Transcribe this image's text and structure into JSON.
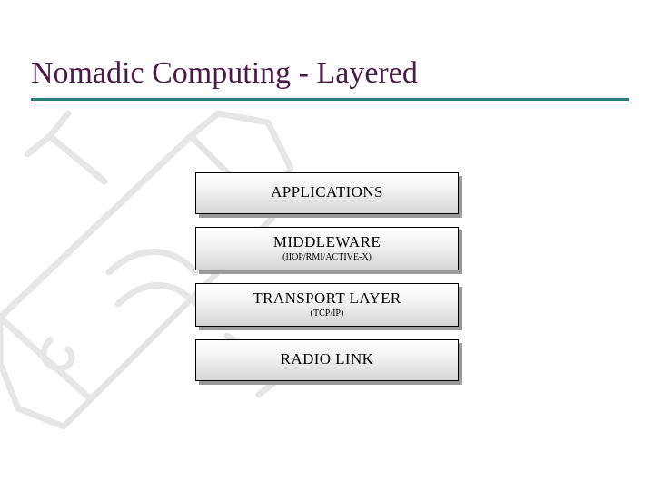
{
  "title": "Nomadic Computing - Layered",
  "layers": [
    {
      "label": "APPLICATIONS",
      "sublabel": ""
    },
    {
      "label": "MIDDLEWARE",
      "sublabel": "(IIOP/RMI/ACTIVE-X)"
    },
    {
      "label": "TRANSPORT LAYER",
      "sublabel": "(TCP/IP)"
    },
    {
      "label": "RADIO LINK",
      "sublabel": ""
    }
  ],
  "colors": {
    "title": "#4b1a4b",
    "rule": "#2d7a7a",
    "box_border": "#000000"
  }
}
